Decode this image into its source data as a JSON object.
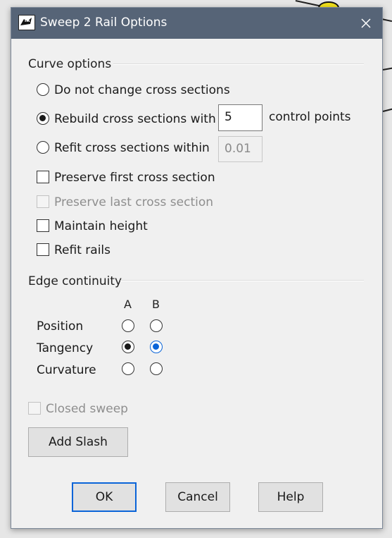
{
  "dialog": {
    "title": "Sweep 2 Rail Options",
    "icon": "beta-rhino-icon",
    "close_icon": "close-icon"
  },
  "curve_options": {
    "heading": "Curve options",
    "radios": [
      {
        "label": "Do not change cross sections",
        "checked": false
      },
      {
        "label": "Rebuild cross sections with",
        "checked": true
      },
      {
        "label": "Refit cross sections within",
        "checked": false
      }
    ],
    "rebuild_value": "5",
    "rebuild_suffix": "control points",
    "refit_value": "0.01",
    "checkboxes": [
      {
        "label": "Preserve first cross section",
        "checked": false,
        "disabled": false
      },
      {
        "label": "Preserve last cross section",
        "checked": false,
        "disabled": true
      },
      {
        "label": "Maintain height",
        "checked": false,
        "disabled": false
      },
      {
        "label": "Refit rails",
        "checked": false,
        "disabled": false
      }
    ]
  },
  "edge_continuity": {
    "heading": "Edge continuity",
    "columns": [
      "A",
      "B"
    ],
    "rows": [
      {
        "label": "Position",
        "a": false,
        "b": false
      },
      {
        "label": "Tangency",
        "a": true,
        "b": true
      },
      {
        "label": "Curvature",
        "a": false,
        "b": false
      }
    ]
  },
  "closed_sweep": {
    "label": "Closed sweep",
    "checked": false,
    "disabled": true
  },
  "buttons": {
    "add_slash": "Add Slash",
    "ok": "OK",
    "cancel": "Cancel",
    "help": "Help"
  },
  "colors": {
    "titlebar": "#566477",
    "focus_accent": "#0a64d8"
  }
}
